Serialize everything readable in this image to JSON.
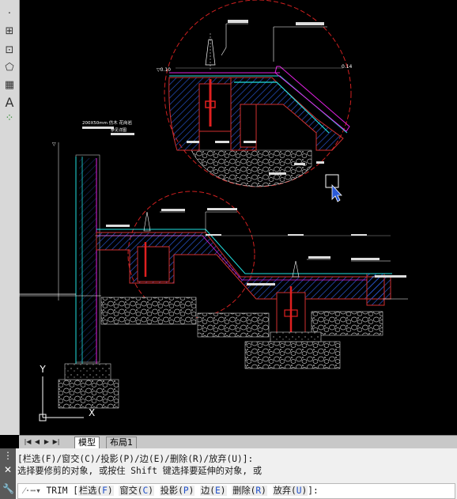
{
  "toolbar": {
    "icons": [
      "point-icon",
      "block-icon",
      "table-icon",
      "region-icon",
      "gradient-icon",
      "text-icon",
      "multileader-icon"
    ]
  },
  "drawing": {
    "annotations": {
      "top_left_elev": "▽0.10",
      "top_right_elev": "0.14",
      "wall_note": "200X50mm 仿木 花岗岩",
      "wall_note2": "参见详图"
    }
  },
  "ucs": {
    "x_label": "X",
    "y_label": "Y"
  },
  "tabs": {
    "model": "模型",
    "layout": "布局1"
  },
  "command": {
    "history_line1": "[栏选(F)/窗交(C)/投影(P)/边(E)/删除(R)/放弃(U)]:",
    "history_line2": "选择要修剪的对象, 或按住 Shift 键选择要延伸的对象, 或",
    "prompt_prefix": "TRIM [",
    "options": [
      {
        "label": "栏选(",
        "key": "F",
        "end": ")"
      },
      {
        "label": "窗交(",
        "key": "C",
        "end": ")"
      },
      {
        "label": "投影(",
        "key": "P",
        "end": ")"
      },
      {
        "label": "边(",
        "key": "E",
        "end": ")"
      },
      {
        "label": "删除(",
        "key": "R",
        "end": ")"
      },
      {
        "label": "放弃(",
        "key": "U",
        "end": ")"
      }
    ],
    "prompt_suffix": "]:"
  }
}
